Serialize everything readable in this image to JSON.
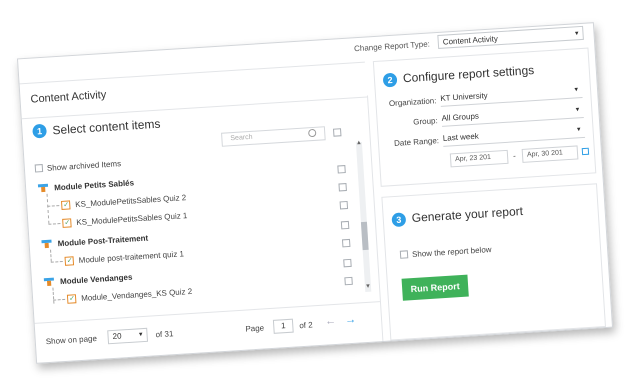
{
  "header": {
    "change_report_type_label": "Change Report Type:",
    "report_type_value": "Content Activity",
    "page_title": "Content Activity"
  },
  "select_content": {
    "step_number": "1",
    "title": "Select content items",
    "search_placeholder": "Search",
    "show_archived_label": "Show archived Items",
    "tree": {
      "module1": {
        "label": "Module Petits Sablés",
        "quiz1": "KS_ModulePetitsSables Quiz 2",
        "quiz2": "KS_ModulePetitsSables Quiz 1"
      },
      "module2": {
        "label": "Module Post-Traitement",
        "quiz1": "Module post-traitement quiz 1"
      },
      "module3": {
        "label": "Module Vendanges",
        "quiz1": "Module_Vendanges_KS Quiz 2"
      }
    },
    "footer": {
      "show_on_page_label": "Show on page",
      "per_page_value": "20",
      "total_text": "of 31",
      "page_label": "Page",
      "page_value": "1",
      "page_total": "of 2",
      "prev_arrow": "←",
      "next_arrow": "→"
    }
  },
  "configure": {
    "step_number": "2",
    "title": "Configure report settings",
    "organization_label": "Organization:",
    "organization_value": "KT University",
    "group_label": "Group:",
    "group_value": "All Groups",
    "date_range_label": "Date Range:",
    "date_range_value": "Last week",
    "date_from": "Apr, 23 201",
    "date_separator": "-",
    "date_to": "Apr, 30 201"
  },
  "generate": {
    "step_number": "3",
    "title": "Generate your report",
    "show_report_label": "Show the report below",
    "run_button": "Run Report"
  },
  "colors": {
    "accent": "#2e9ee6",
    "run_button": "#3fb25a"
  }
}
